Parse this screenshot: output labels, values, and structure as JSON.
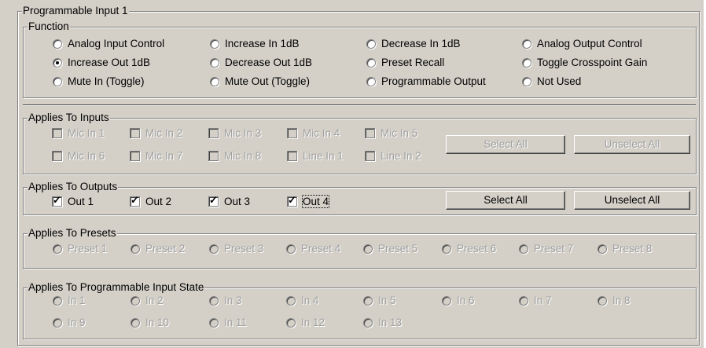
{
  "title": "Programmable Input 1",
  "function": {
    "legend": "Function",
    "options": [
      {
        "label": "Analog Input Control",
        "selected": false
      },
      {
        "label": "Increase In 1dB",
        "selected": false
      },
      {
        "label": "Decrease In 1dB",
        "selected": false
      },
      {
        "label": "Analog Output Control",
        "selected": false
      },
      {
        "label": "Increase Out 1dB",
        "selected": true
      },
      {
        "label": "Decrease Out 1dB",
        "selected": false
      },
      {
        "label": "Preset Recall",
        "selected": false
      },
      {
        "label": "Toggle Crosspoint Gain",
        "selected": false
      },
      {
        "label": "Mute In (Toggle)",
        "selected": false
      },
      {
        "label": "Mute Out (Toggle)",
        "selected": false
      },
      {
        "label": "Programmable Output",
        "selected": false
      },
      {
        "label": "Not Used",
        "selected": false
      }
    ]
  },
  "inputs": {
    "legend": "Applies To Inputs",
    "items": [
      "Mic In 1",
      "Mic In 2",
      "Mic In 3",
      "Mic In 4",
      "Mic In 5",
      "Mic In 6",
      "Mic In 7",
      "Mic In 8",
      "Line In 1",
      "Line In 2"
    ],
    "select_all": "Select All",
    "unselect_all": "Unselect All"
  },
  "outputs": {
    "legend": "Applies To Outputs",
    "items": [
      {
        "label": "Out 1",
        "checked": true
      },
      {
        "label": "Out 2",
        "checked": true
      },
      {
        "label": "Out 3",
        "checked": true
      },
      {
        "label": "Out 4",
        "checked": true
      }
    ],
    "select_all": "Select All",
    "unselect_all": "Unselect All"
  },
  "presets": {
    "legend": "Applies To Presets",
    "items": [
      "Preset 1",
      "Preset 2",
      "Preset 3",
      "Preset 4",
      "Preset 5",
      "Preset 6",
      "Preset 7",
      "Preset 8"
    ]
  },
  "states": {
    "legend": "Applies To Programmable Input State",
    "items": [
      "In 1",
      "In 2",
      "In 3",
      "In 4",
      "In 5",
      "In 6",
      "In 7",
      "In 8",
      "In 9",
      "In 10",
      "In 11",
      "In 12",
      "In 13"
    ]
  }
}
